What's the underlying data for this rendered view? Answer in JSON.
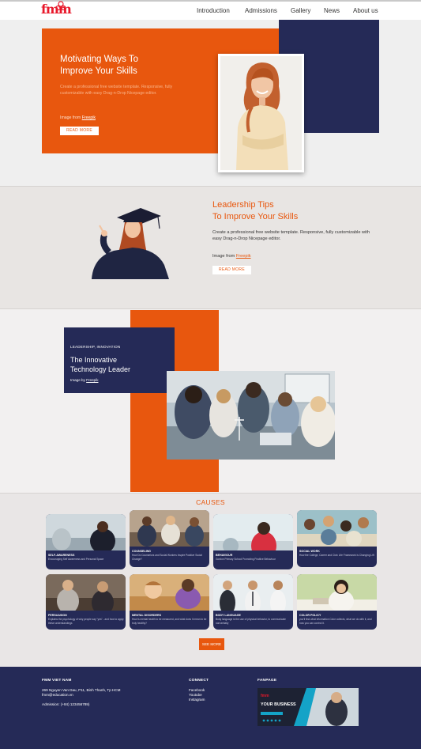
{
  "header": {
    "logo_text": "fmm",
    "nav": [
      "Introduction",
      "Admissions",
      "Gallery",
      "News",
      "About us"
    ]
  },
  "hero": {
    "title_line1": "Motivating Ways To",
    "title_line2": "Improve Your Skills",
    "description": "Create a professional free website template. Responsive, fully customizable with easy Drag-n-Drop Nicepage editor.",
    "credit_prefix": "Image from ",
    "credit_link": "Freepik",
    "button": "READ MORE"
  },
  "leadership": {
    "title_line1": "Leadership Tips",
    "title_line2": "To Improve Your Skills",
    "description": "Create a professional free website template. Responsive, fully customizable with easy Drag-n-Drop Nicepage editor.",
    "credit_prefix": "Image from ",
    "credit_link": "Freepik",
    "button": "READ MORE"
  },
  "innovation": {
    "kicker": "LEADERSHIP, INNOVATION",
    "title_line1": "The Innovative",
    "title_line2": "Technology Leader",
    "credit_prefix": "Image by ",
    "credit_link": "Freepik"
  },
  "causes": {
    "title": "CAUSES",
    "cards": [
      {
        "title": "SELF-AWARENESS",
        "desc": "Encouraging Self Awareness and Personal Space"
      },
      {
        "title": "COUNSELING",
        "desc": "How Do Counselors and Social Workers Inspire Positive Social Change?"
      },
      {
        "title": "BEHAVIOUR",
        "desc": "Gordon Primary School Promoting Positive Behaviour"
      },
      {
        "title": "SOCIAL WORK",
        "desc": "How the College, Career and Civic Life Framework is Changing Lift"
      },
      {
        "title": "PERSUASION",
        "desc": "Explains the psychology of why people say \"yes\" - and how to apply these understandings"
      },
      {
        "title": "MENTAL DISORDERS",
        "desc": "How is mental health to be measured, and what does it mean to be truly healthy?"
      },
      {
        "title": "BODY LANGUAGE",
        "desc": "Body language is the use of physical behavior, to communicate nonverbally"
      },
      {
        "title": "COLOR POLICY",
        "desc": "you'll find what information Color collects, what we do with it, and how you can control it."
      }
    ],
    "button": "SEE MORE"
  },
  "footer": {
    "org": "FMM VIET NAM",
    "address": "269 Nguyen Van Dau, P11, Binh Thanh, Tp HCM",
    "email": "fmm@education.vn",
    "admission": "Admission: (+84) 123456789)",
    "connect_title": "CONNECT",
    "connect_links": [
      "Facebook",
      "Youtube",
      "Instagram"
    ],
    "fanpage_title": "FANPAGE",
    "fanpage_banner": "YOUR BUSINESS"
  },
  "colors": {
    "orange": "#e8570e",
    "navy": "#252a57",
    "logo_red": "#e8182a"
  }
}
